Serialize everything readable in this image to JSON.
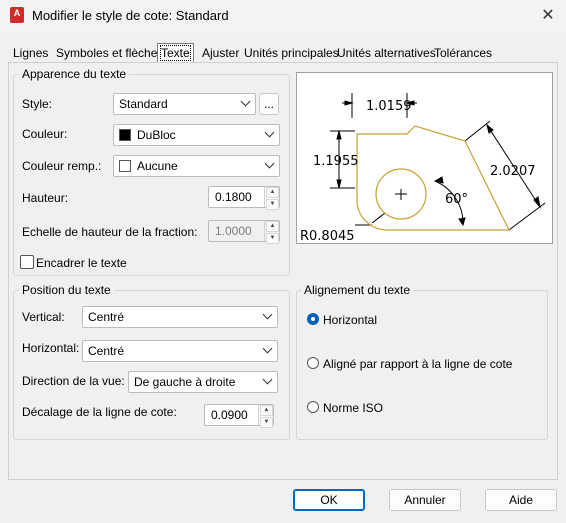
{
  "window": {
    "title": "Modifier le style de cote: Standard",
    "app_icon": "A",
    "close": "✕"
  },
  "tabs": [
    {
      "label": "Lignes"
    },
    {
      "label": "Symboles et flèches"
    },
    {
      "label": "Texte"
    },
    {
      "label": "Ajuster"
    },
    {
      "label": "Unités principales"
    },
    {
      "label": "Unités alternatives"
    },
    {
      "label": "Tolérances"
    }
  ],
  "active_tab": "Texte",
  "text_appearance": {
    "group_label": "Apparence du texte",
    "style_label": "Style:",
    "style_value": "Standard",
    "style_browse": "...",
    "color_label": "Couleur:",
    "color_value": "DuBloc",
    "color_swatch": "#000000",
    "fill_color_label": "Couleur remp.:",
    "fill_color_value": "Aucune",
    "fill_swatch": "#ffffff",
    "height_label": "Hauteur:",
    "height_value": "0.1800",
    "fraction_scale_label": "Echelle de hauteur de la fraction:",
    "fraction_scale_value": "1.0000",
    "frame_label": "Encadrer le texte",
    "frame_checked": false
  },
  "text_position": {
    "group_label": "Position du texte",
    "vertical_label": "Vertical:",
    "vertical_value": "Centré",
    "horizontal_label": "Horizontal:",
    "horizontal_value": "Centré",
    "view_direction_label": "Direction de la vue:",
    "view_direction_value": "De gauche à droite",
    "offset_label": "Décalage de la ligne de cote:",
    "offset_value": "0.0900"
  },
  "text_alignment": {
    "group_label": "Alignement du texte",
    "options": [
      {
        "label": "Horizontal",
        "checked": true
      },
      {
        "label": "Aligné par rapport à la ligne de cote",
        "checked": false
      },
      {
        "label": "Norme ISO",
        "checked": false
      }
    ]
  },
  "preview": {
    "dim_top": "1.0159",
    "dim_left": "1.1955",
    "dim_right": "2.0207",
    "angle": "60°",
    "radius": "R0.8045",
    "shape_color": "#c8a034"
  },
  "buttons": {
    "ok": "OK",
    "cancel": "Annuler",
    "help": "Aide"
  }
}
